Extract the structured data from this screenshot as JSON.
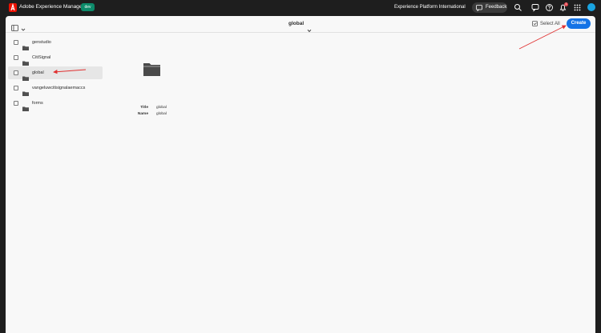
{
  "topbar": {
    "app_title": "Adobe Experience Manager",
    "env_badge": "dev",
    "org_name": "Experience Platform International",
    "feedback_label": "Feedback",
    "notification_count": "1",
    "icons": [
      "search-icon",
      "chat-icon",
      "help-icon",
      "bell-icon",
      "apps-grid-icon",
      "avatar"
    ]
  },
  "header": {
    "folder_title": "global",
    "select_all_label": "Select All",
    "create_label": "Create"
  },
  "folders": [
    {
      "label": "genstudio",
      "selected": false
    },
    {
      "label": "CitiSignal",
      "selected": false
    },
    {
      "label": "global",
      "selected": true
    },
    {
      "label": "vangeluwcitisignalaemaccs",
      "selected": false
    },
    {
      "label": "forms",
      "selected": false
    }
  ],
  "preview": {
    "title_label": "Title",
    "title_value": "global",
    "name_label": "Name",
    "name_value": "global"
  },
  "colors": {
    "topbar_bg": "#1e1e1e",
    "accent": "#1473e6",
    "env_badge": "#0d8a6a",
    "adobe_red": "#eb1000",
    "annotation_arrow": "#e03030"
  }
}
